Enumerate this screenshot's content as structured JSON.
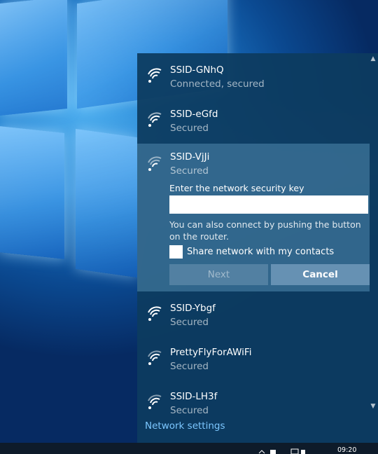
{
  "networks_top": [
    {
      "ssid": "SSID-GNhQ",
      "status": "Connected, secured"
    },
    {
      "ssid": "SSID-eGfd",
      "status": "Secured"
    }
  ],
  "expanded": {
    "ssid": "SSID-VjJi",
    "status": "Secured",
    "key_label": "Enter the network security key",
    "key_value": "",
    "wps_hint": "You can also connect by pushing the button on the router.",
    "share_label": "Share network with my contacts",
    "share_checked": false,
    "next_label": "Next",
    "cancel_label": "Cancel"
  },
  "networks_bottom": [
    {
      "ssid": "SSID-Ybgf",
      "status": "Secured"
    },
    {
      "ssid": "PrettyFlyForAWiFi",
      "status": "Secured"
    },
    {
      "ssid": "SSID-LH3f",
      "status": "Secured"
    }
  ],
  "settings_link": "Network settings",
  "taskbar": {
    "clock_time": "09:20"
  },
  "colors": {
    "flyout_bg": "#0d3c60",
    "link": "#7cc7ff",
    "expanded_bg": "#386e94"
  },
  "icons": [
    "wifi-signal-icon",
    "scroll-up-icon",
    "scroll-down-icon"
  ]
}
